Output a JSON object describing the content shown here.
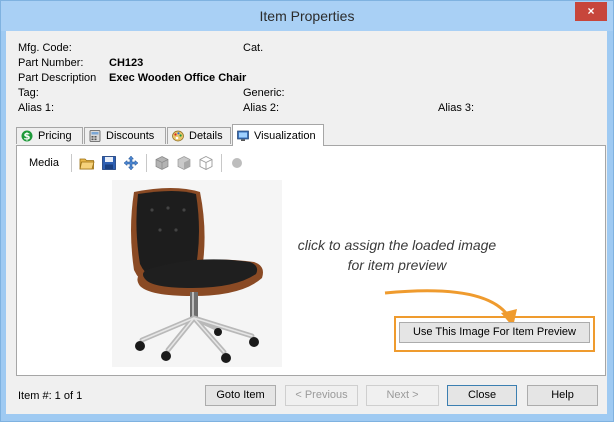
{
  "window": {
    "title": "Item Properties",
    "close_label": "×"
  },
  "header": {
    "mfg_code_label": "Mfg. Code:",
    "cat_label": "Cat.",
    "part_number_label": "Part Number:",
    "part_number_value": "CH123",
    "part_description_label": "Part Description",
    "part_description_value": "Exec Wooden Office Chair",
    "tag_label": "Tag:",
    "generic_label": "Generic:",
    "alias1_label": "Alias 1:",
    "alias2_label": "Alias 2:",
    "alias3_label": "Alias 3:"
  },
  "tabs": [
    {
      "label": "Pricing",
      "icon": "dollar-icon"
    },
    {
      "label": "Discounts",
      "icon": "calculator-icon"
    },
    {
      "label": "Details",
      "icon": "palette-icon"
    },
    {
      "label": "Visualization",
      "icon": "monitor-icon",
      "active": true
    }
  ],
  "media_toolbar": {
    "label": "Media",
    "icons": [
      "open-folder-icon",
      "save-icon",
      "move-icon",
      "cube-solid-icon",
      "cube-shaded-icon",
      "cube-wire-icon",
      "circle-icon"
    ]
  },
  "callout": {
    "text": "click to assign the loaded image for item preview"
  },
  "use_image_button": "Use This Image For Item Preview",
  "footer": {
    "item_counter": "Item #: 1 of 1",
    "goto_item": "Goto Item",
    "previous": "< Previous",
    "next": "Next >",
    "close": "Close",
    "help": "Help"
  },
  "colors": {
    "highlight": "#ef9b2e",
    "titlebar": "#a9d0f5",
    "close": "#c7463b"
  }
}
